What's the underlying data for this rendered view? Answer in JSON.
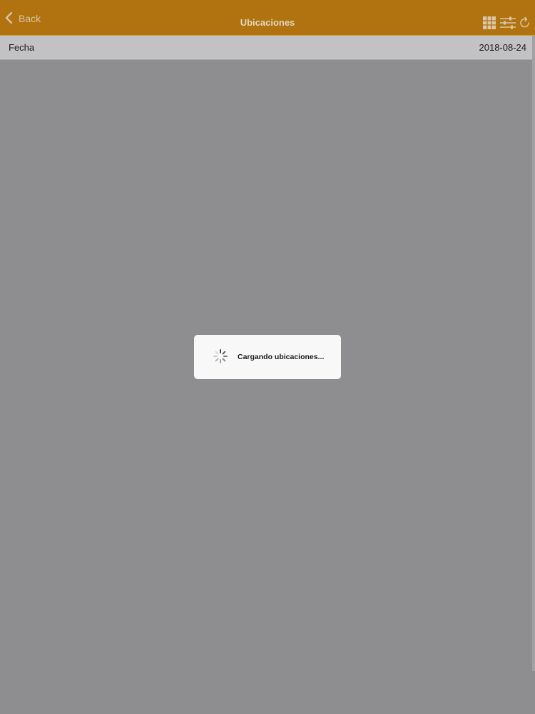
{
  "navbar": {
    "back_label": "Back",
    "title": "Ubicaciones",
    "icons": [
      "grid-icon",
      "sliders-icon",
      "refresh-icon"
    ]
  },
  "date_row": {
    "label": "Fecha",
    "value": "2018-08-24"
  },
  "loading": {
    "message": "Cargando ubicaciones..."
  },
  "colors": {
    "navbar": "#b0730f",
    "overlay": "#8e8e90",
    "date_row": "#c2c2c4",
    "dialog": "#f8f8f8"
  }
}
